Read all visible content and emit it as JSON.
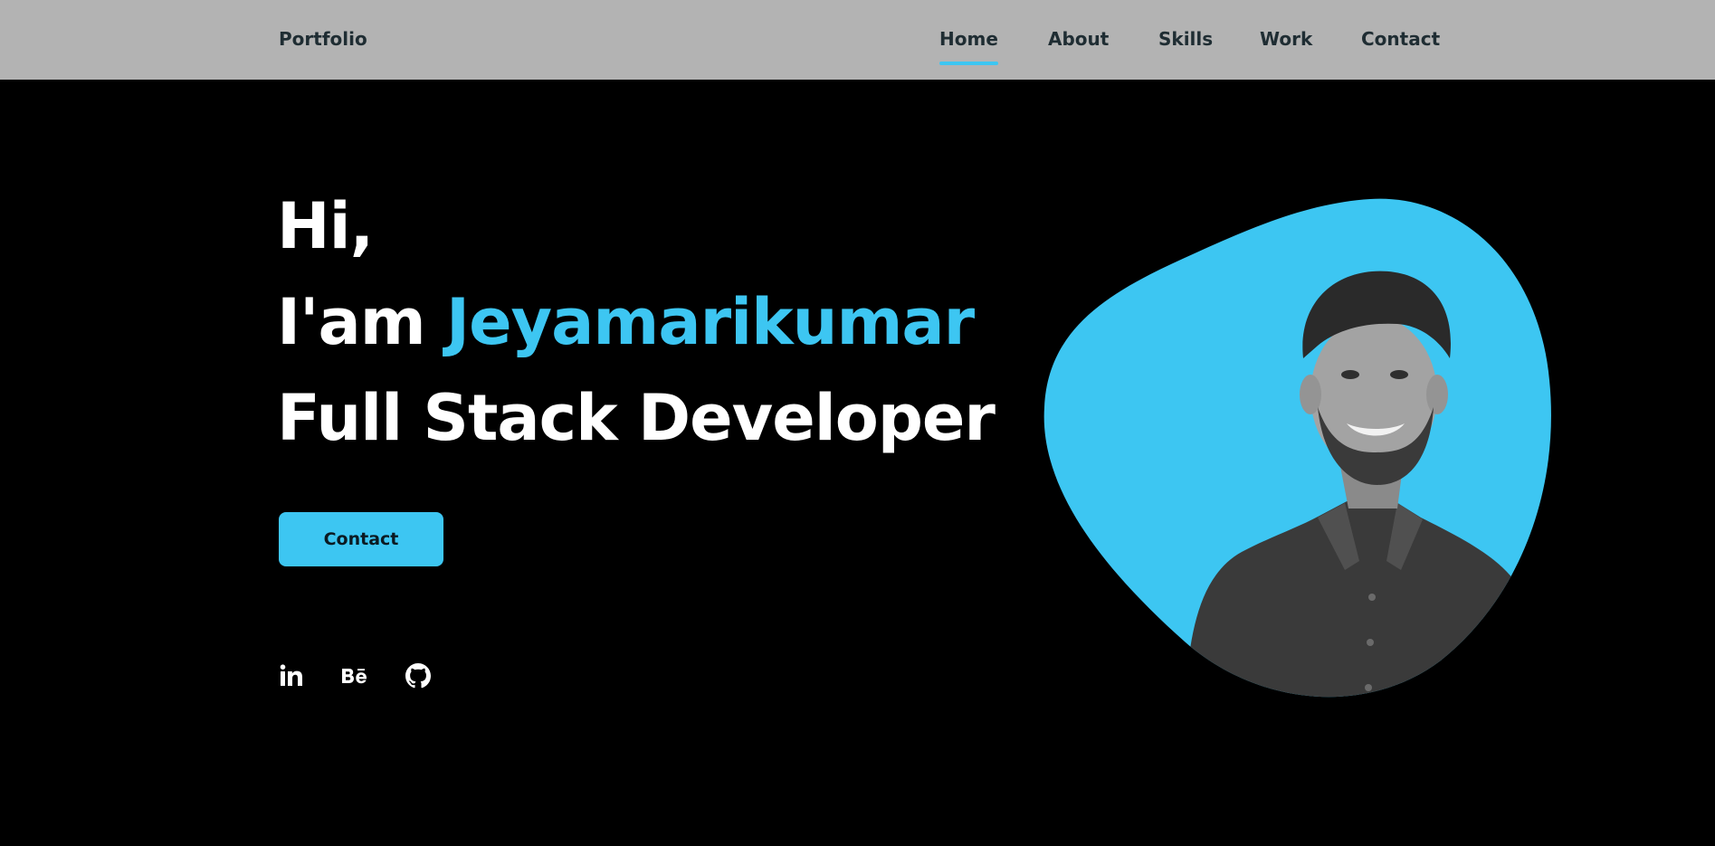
{
  "header": {
    "logo": "Portfolio",
    "nav": [
      {
        "label": "Home",
        "active": true
      },
      {
        "label": "About",
        "active": false
      },
      {
        "label": "Skills",
        "active": false
      },
      {
        "label": "Work",
        "active": false
      },
      {
        "label": "Contact",
        "active": false
      }
    ]
  },
  "hero": {
    "greeting": "Hi,",
    "intro_prefix": "I'am",
    "name": "Jeyamarikumar",
    "role": "Full Stack Developer",
    "cta_label": "Contact",
    "social": [
      {
        "icon": "linkedin-icon"
      },
      {
        "icon": "behance-icon"
      },
      {
        "icon": "github-icon"
      }
    ],
    "photo_alt": "portrait-photo"
  },
  "colors": {
    "header_bg": "#b3b3b3",
    "page_bg": "#000000",
    "accent": "#3dc6f2",
    "nav_text": "#1f2d33",
    "hero_text": "#ffffff"
  }
}
